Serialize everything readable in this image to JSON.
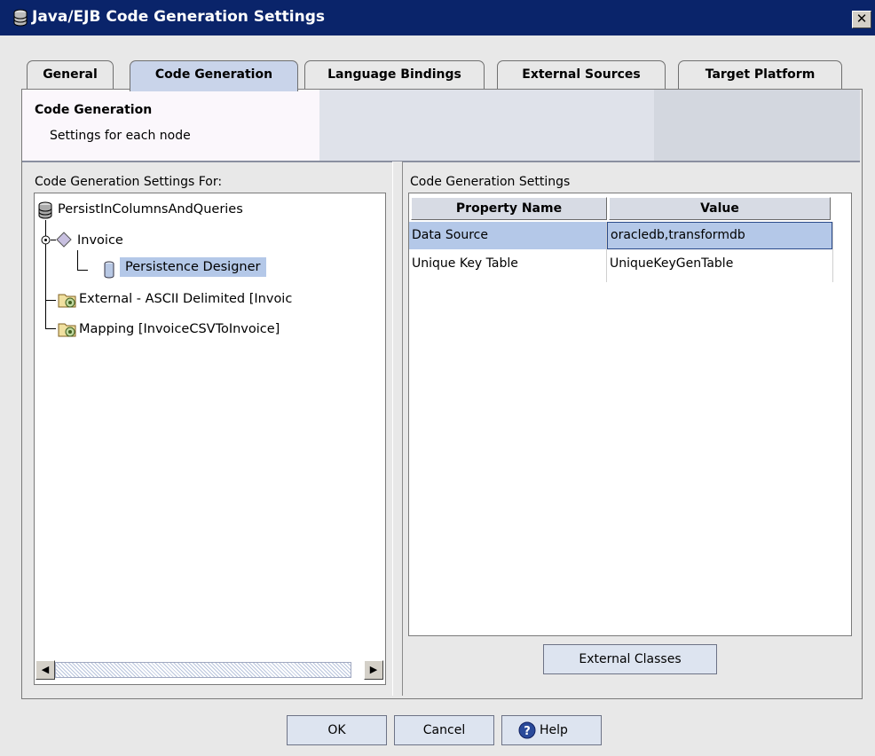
{
  "window": {
    "title": "Java/EJB Code Generation Settings",
    "close_glyph": "✕"
  },
  "tabs": [
    {
      "label": "General",
      "active": false
    },
    {
      "label": "Code Generation",
      "active": true
    },
    {
      "label": "Language Bindings",
      "active": false
    },
    {
      "label": "External Sources",
      "active": false
    },
    {
      "label": "Target Platform",
      "active": false
    }
  ],
  "header": {
    "title": "Code Generation",
    "subtitle": "Settings for each node"
  },
  "left_panel": {
    "label": "Code Generation Settings For:",
    "tree": {
      "root": "PersistInColumnsAndQueries",
      "invoice": "Invoice",
      "persistence": "Persistence Designer",
      "external": "External - ASCII Delimited [Invoic",
      "mapping": "Mapping [InvoiceCSVToInvoice]"
    }
  },
  "right_panel": {
    "label": "Code Generation Settings",
    "columns": [
      "Property Name",
      "Value"
    ],
    "rows": [
      {
        "property": "Data Source",
        "value": "oracledb,transformdb",
        "selected": true
      },
      {
        "property": "Unique Key Table",
        "value": "UniqueKeyGenTable",
        "selected": false
      }
    ],
    "external_classes_button": "External Classes"
  },
  "footer": {
    "ok": "OK",
    "cancel": "Cancel",
    "help": "Help"
  },
  "colors": {
    "title_bar": "#0a246a",
    "selection": "#b4c8e8",
    "active_tab": "#c9d4ea"
  }
}
